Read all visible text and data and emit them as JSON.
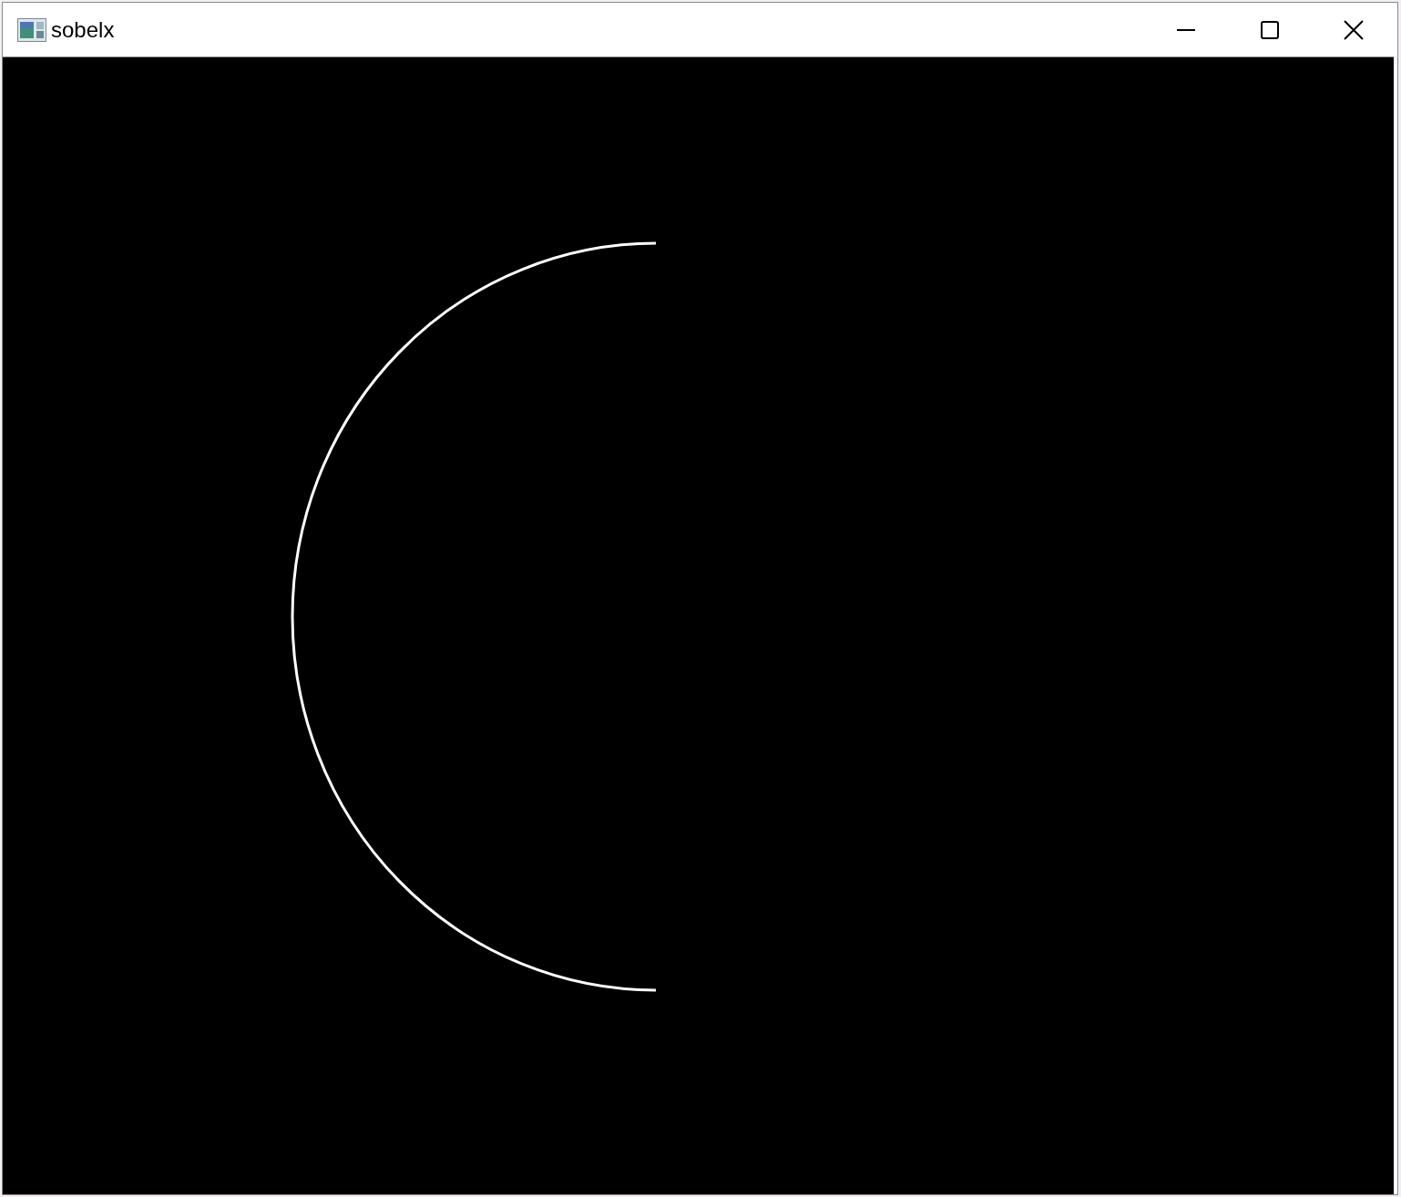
{
  "window": {
    "title": "sobelx"
  }
}
